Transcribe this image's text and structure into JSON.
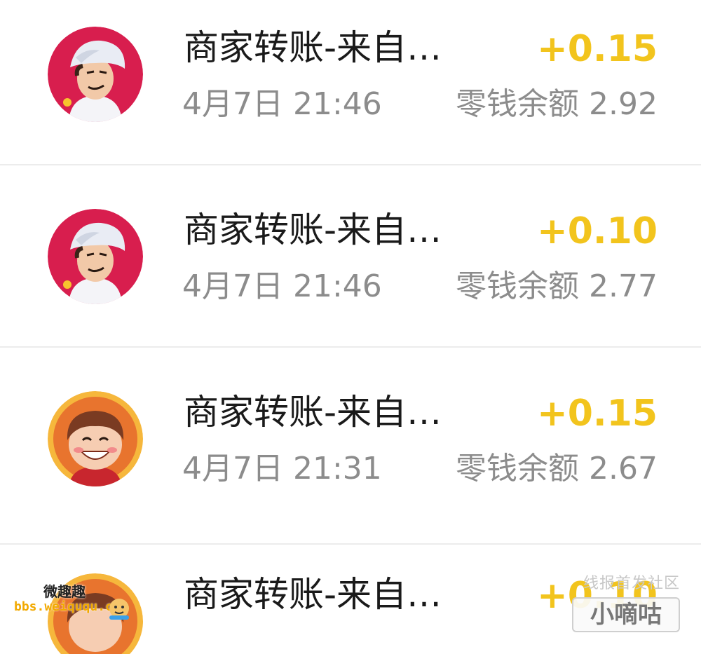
{
  "transactions": [
    {
      "title": "商家转账-来自…",
      "amount": "+0.15",
      "time": "4月7日 21:46",
      "balance_label": "零钱余额",
      "balance": "2.92",
      "avatar": "chef-avatar"
    },
    {
      "title": "商家转账-来自…",
      "amount": "+0.10",
      "time": "4月7日 21:46",
      "balance_label": "零钱余额",
      "balance": "2.77",
      "avatar": "chef-avatar"
    },
    {
      "title": "商家转账-来自…",
      "amount": "+0.15",
      "time": "4月7日 21:31",
      "balance_label": "零钱余额",
      "balance": "2.67",
      "avatar": "smiling-boy-avatar"
    },
    {
      "title": "商家转账-来自…",
      "amount": "+0.10",
      "avatar": "smiling-boy-avatar"
    }
  ],
  "watermarks": {
    "left_title": "微趣趣",
    "left_url": "bbs.weiququ.cc",
    "right_top": "线报首发社区",
    "right_badge": "小嘀咕"
  },
  "colors": {
    "amount": "#f2c41d",
    "secondary_text": "#8c8c8c",
    "primary_text": "#1a1a1a",
    "divider": "#ececec"
  }
}
